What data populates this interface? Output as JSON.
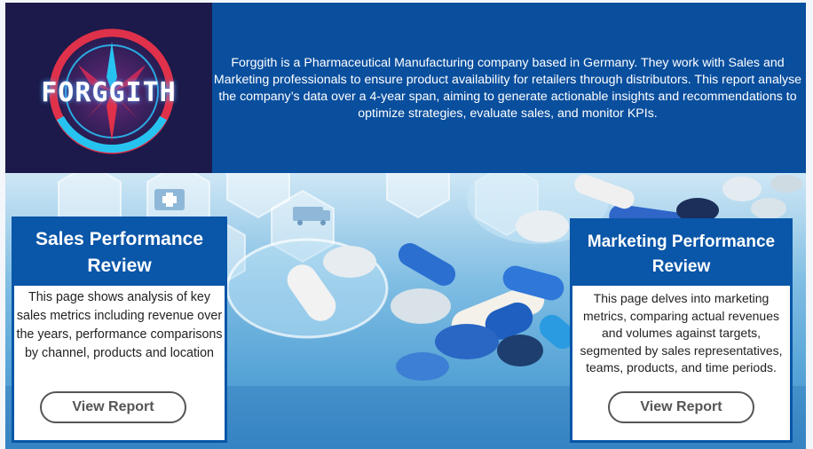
{
  "header": {
    "logo_text": "FORGGITH",
    "intro": "Forggith is a Pharmaceutical Manufacturing company based in Germany. They work with Sales and Marketing professionals to ensure product availability for retailers through distributors. This report analyse the company’s data over a 4-year span, aiming to generate actionable insights and recommendations to optimize strategies, evaluate sales, and monitor KPIs."
  },
  "sales_card": {
    "title": "Sales Performance Review",
    "description": "This page shows analysis of key sales metrics including revenue over the years, performance comparisons by channel, products and location",
    "button_label": "View Report"
  },
  "marketing_card": {
    "title": "Marketing Performance Review",
    "description": "This page delves into marketing metrics, comparing actual revenues and volumes against targets, segmented by sales representatives, teams, products, and time periods.",
    "button_label": "View Report"
  },
  "colors": {
    "banner_blue": "#0a4f9e",
    "card_header_blue": "#0a56a8",
    "logo_bg": "#1b1a4a",
    "logo_red": "#e0314a",
    "logo_cyan": "#27c3f0"
  },
  "icons": [
    "compass-logo-icon",
    "medical-kit-icon",
    "ambulance-icon"
  ]
}
